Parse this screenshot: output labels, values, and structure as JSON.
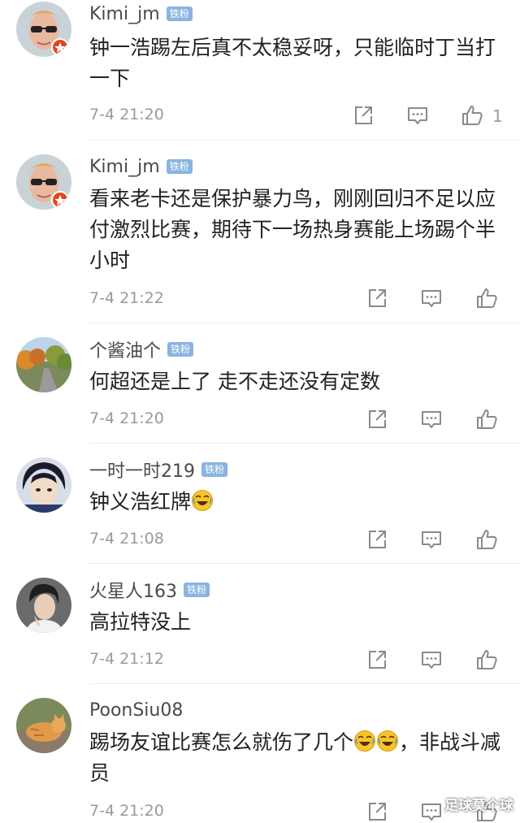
{
  "badge_label": "铁粉",
  "watermark": "足球莫个球",
  "comments": [
    {
      "user": "Kimi_jm",
      "text": "钟一浩踢左后真不太稳妥呀，只能临时丁当打一下",
      "time": "7-4 21:20",
      "likes": "1",
      "avatar": "blond-man-sunglasses"
    },
    {
      "user": "Kimi_jm",
      "text": "看来老卡还是保护暴力鸟，刚刚回归不足以应付激烈比赛，期待下一场热身赛能上场踢个半小时",
      "time": "7-4 21:22",
      "likes": "",
      "avatar": "blond-man-sunglasses"
    },
    {
      "user": "个酱油个",
      "text": "何超还是上了 走不走还没有定数",
      "time": "7-4 21:20",
      "likes": "",
      "avatar": "autumn-road"
    },
    {
      "user": "一时一时219",
      "text": "钟义浩红牌",
      "time": "7-4 21:08",
      "likes": "",
      "avatar": "anime-character"
    },
    {
      "user": "火星人163",
      "text": "高拉特没上",
      "time": "7-4 21:12",
      "likes": "",
      "avatar": "young-man"
    },
    {
      "user": "PoonSiu08",
      "text": "踢场友谊比赛怎么就伤了几个",
      "text_after": "，非战斗减员",
      "time": "7-4 21:20",
      "likes": "",
      "avatar": "orange-cat"
    }
  ],
  "colors": {
    "text": "#222222",
    "meta": "#9a9a9a",
    "badge": "#8ab4e0"
  }
}
